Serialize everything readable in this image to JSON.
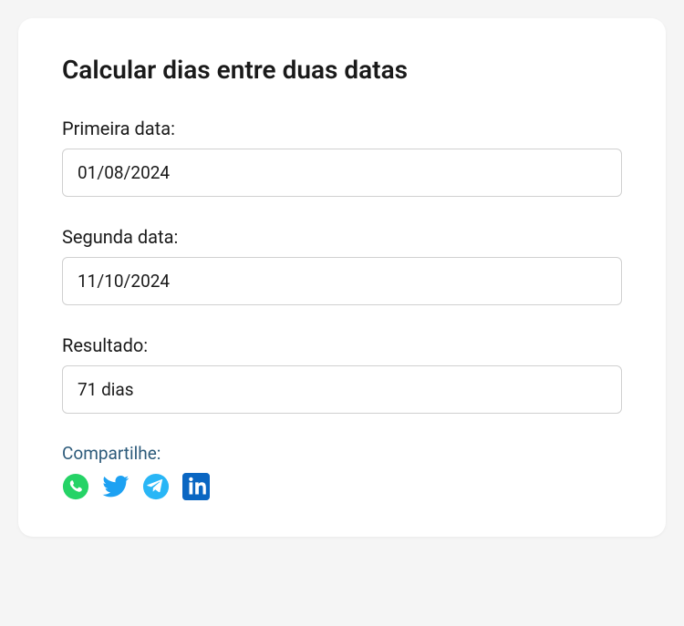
{
  "title": "Calcular dias entre duas datas",
  "fields": {
    "firstDate": {
      "label": "Primeira data:",
      "value": "01/08/2024"
    },
    "secondDate": {
      "label": "Segunda data:",
      "value": "11/10/2024"
    },
    "result": {
      "label": "Resultado:",
      "value": "71 dias"
    }
  },
  "share": {
    "label": "Compartilhe:"
  }
}
